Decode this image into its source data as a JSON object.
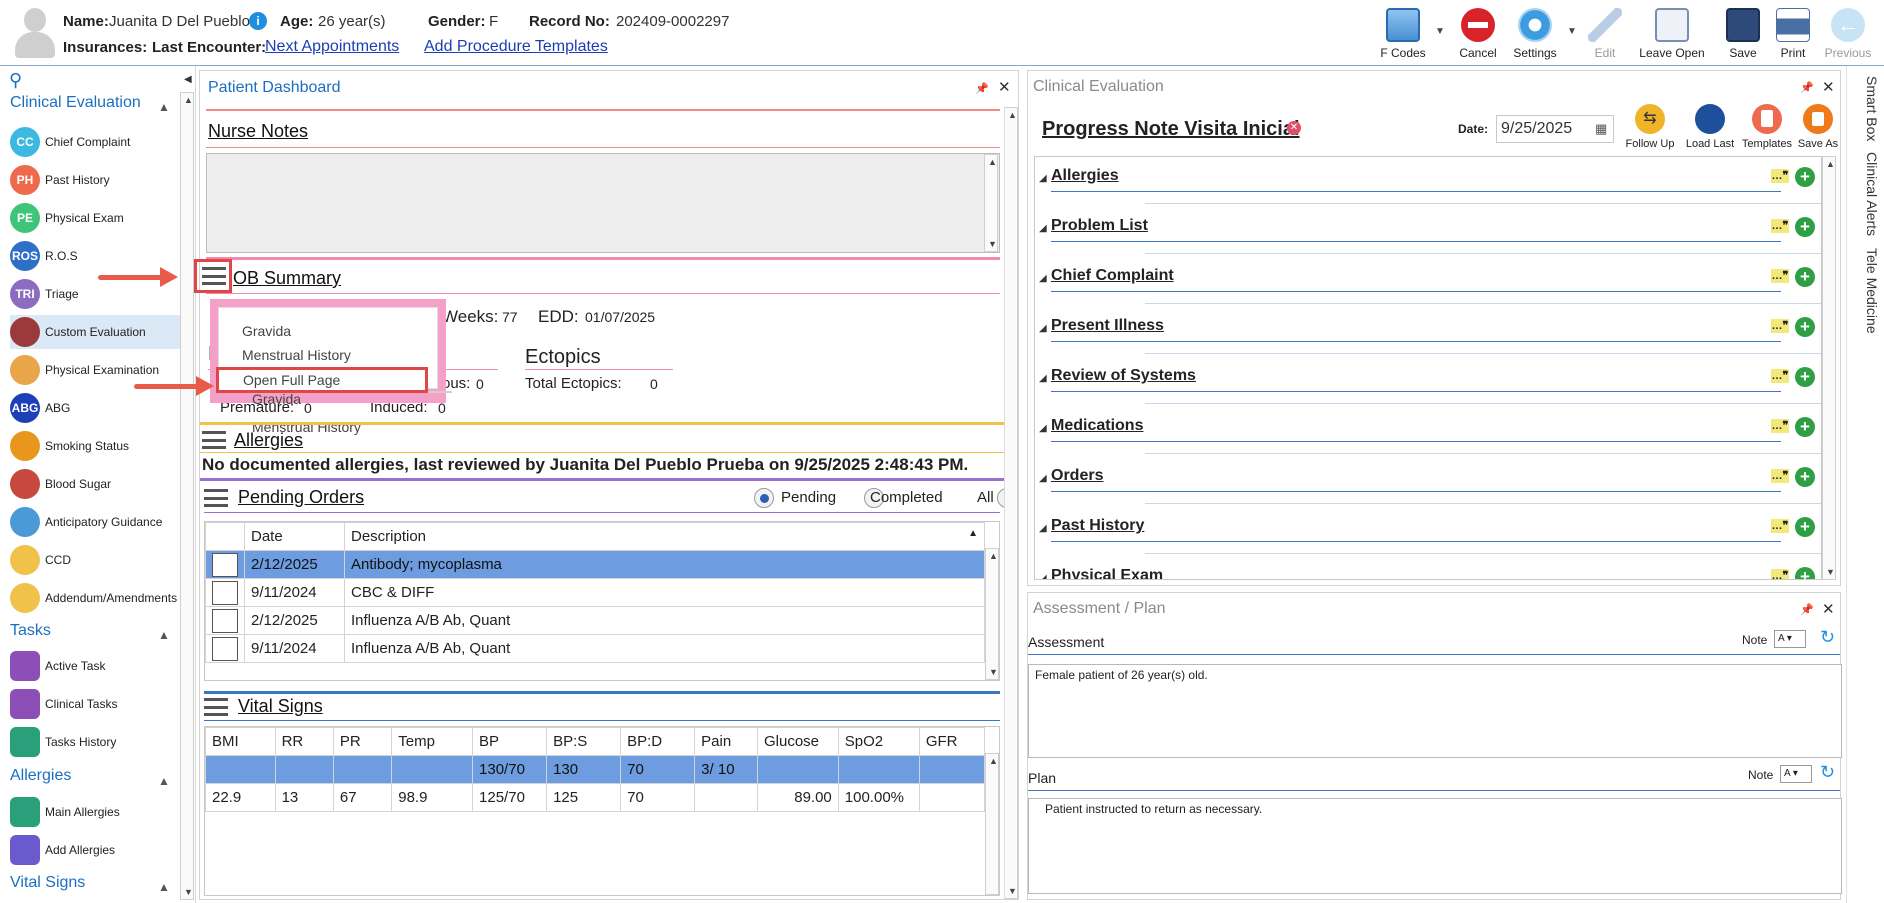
{
  "header": {
    "name_label": "Name:",
    "name_value": "Juanita D Del Pueblo",
    "age_label": "Age:",
    "age_value": "26 year(s)",
    "gender_label": "Gender:",
    "gender_value": "F",
    "record_label": "Record No:",
    "record_value": "202409-0002297",
    "insurances_label": "Insurances:",
    "last_encounter_label": "Last Encounter:",
    "next_appointments_link": "Next Appointments",
    "add_procedure_link": "Add Procedure Templates"
  },
  "toolbar": {
    "fcodes": "F Codes",
    "cancel": "Cancel",
    "settings": "Settings",
    "edit": "Edit",
    "leave_open": "Leave Open",
    "save": "Save",
    "print": "Print",
    "previous": "Previous"
  },
  "sidebar": {
    "clinical_evaluation": "Clinical Evaluation",
    "items": [
      {
        "icon": "CC",
        "label": "Chief Complaint",
        "color": "#3db8e0"
      },
      {
        "icon": "PH",
        "label": "Past History",
        "color": "#ef6a4c"
      },
      {
        "icon": "PE",
        "label": "Physical Exam",
        "color": "#3fc47a"
      },
      {
        "icon": "ROS",
        "label": "R.O.S",
        "color": "#2f6fc8"
      },
      {
        "icon": "TRI",
        "label": "Triage",
        "color": "#8c6cc0"
      },
      {
        "icon": "stethoscope-icon",
        "label": "Custom Evaluation",
        "color": "#9a3a3a"
      },
      {
        "icon": "clipboard-icon",
        "label": "Physical Examination",
        "color": "#e8a54a"
      },
      {
        "icon": "ABG",
        "label": "ABG",
        "color": "#1d3fb8"
      },
      {
        "icon": "no-smoking-icon",
        "label": "Smoking Status",
        "color": "#e8961c"
      },
      {
        "icon": "blood-drop-icon",
        "label": "Blood Sugar",
        "color": "#c8473e"
      },
      {
        "icon": "guidance-icon",
        "label": "Anticipatory Guidance",
        "color": "#4a9ad8"
      },
      {
        "icon": "folder-icon",
        "label": "CCD",
        "color": "#f0c24a"
      },
      {
        "icon": "document-icon",
        "label": "Addendum/Amendments",
        "color": "#f0c24a"
      }
    ],
    "tasks": "Tasks",
    "task_items": [
      {
        "label": "Active Task",
        "color": "#8c4fb8"
      },
      {
        "label": "Clinical Tasks",
        "color": "#8c4fb8"
      },
      {
        "label": "Tasks History",
        "color": "#2aa07a"
      }
    ],
    "allergies": "Allergies",
    "allergy_items": [
      {
        "label": "Main Allergies",
        "color": "#2aa07a"
      },
      {
        "label": "Add Allergies",
        "color": "#6a5acd"
      }
    ],
    "vital_signs": "Vital Signs"
  },
  "dashboard": {
    "title": "Patient Dashboard",
    "nurse_notes": "Nurse Notes",
    "ob_summary": "OB Summary",
    "weeks_label": "Weeks:",
    "weeks_value": "77",
    "edd_label": "EDD:",
    "edd_value": "01/07/2025",
    "ectopics_title": "Ectopics",
    "total_ectopics": "Total Ectopics:",
    "total_ectopics_value": "0",
    "spont_label": "ous:",
    "spont_value": "0",
    "premature_label": "Premature:",
    "premature_value": "0",
    "induced_label": "Induced:",
    "induced_value": "0",
    "p_label": "P",
    "menu": {
      "gravida": "Gravida",
      "menstrual": "Menstrual History",
      "open_full": "Open Full Page"
    },
    "allergies_title": "Allergies",
    "allergies_text": "No documented allergies, last reviewed by Juanita Del Pueblo Prueba on 9/25/2025 2:48:43 PM.",
    "pending_orders": "Pending Orders",
    "radio": {
      "pending": "Pending",
      "completed": "Completed",
      "all": "All"
    },
    "orders_headers": [
      "Date",
      "Description"
    ],
    "orders": [
      {
        "date": "2/12/2025",
        "desc": "Antibody; mycoplasma"
      },
      {
        "date": "9/11/2024",
        "desc": "CBC & DIFF"
      },
      {
        "date": "2/12/2025",
        "desc": "Influenza A/B Ab, Quant"
      },
      {
        "date": "9/11/2024",
        "desc": "Influenza A/B Ab, Quant"
      }
    ],
    "vital_signs": "Vital Signs",
    "vitals_headers": [
      "BMI",
      "RR",
      "PR",
      "Temp",
      "BP",
      "BP:S",
      "BP:D",
      "Pain",
      "Glucose",
      "SpO2",
      "GFR"
    ],
    "vitals_rows": [
      [
        "",
        "",
        "",
        "",
        "130/70",
        "130",
        "70",
        "3/ 10",
        "",
        "",
        ""
      ],
      [
        "22.9",
        "13",
        "67",
        "98.9",
        "125/70",
        "125",
        "70",
        "",
        "89.00",
        "100.00%",
        ""
      ]
    ]
  },
  "clinical": {
    "title": "Clinical Evaluation",
    "note_title": "Progress Note Visita Inicial",
    "date_label": "Date:",
    "date_value": "9/25/2025",
    "follow_up": "Follow Up",
    "load_last": "Load Last",
    "templates": "Templates",
    "save_as": "Save As",
    "sections": [
      "Allergies",
      "Problem List",
      "Chief Complaint",
      "Present Illness",
      "Review of Systems",
      "Medications",
      "Orders",
      "Past History",
      "Physical Exam"
    ]
  },
  "assessment": {
    "title": "Assessment / Plan",
    "assessment_label": "Assessment",
    "note_label": "Note",
    "assessment_text": "Female patient of 26 year(s) old.",
    "plan_label": "Plan",
    "plan_text": "Patient instructed to return as necessary."
  },
  "right_tabs": {
    "smart_box": "Smart Box",
    "clinical_alerts": "Clinical Alerts",
    "tele_medicine": "Tele Medicine"
  }
}
